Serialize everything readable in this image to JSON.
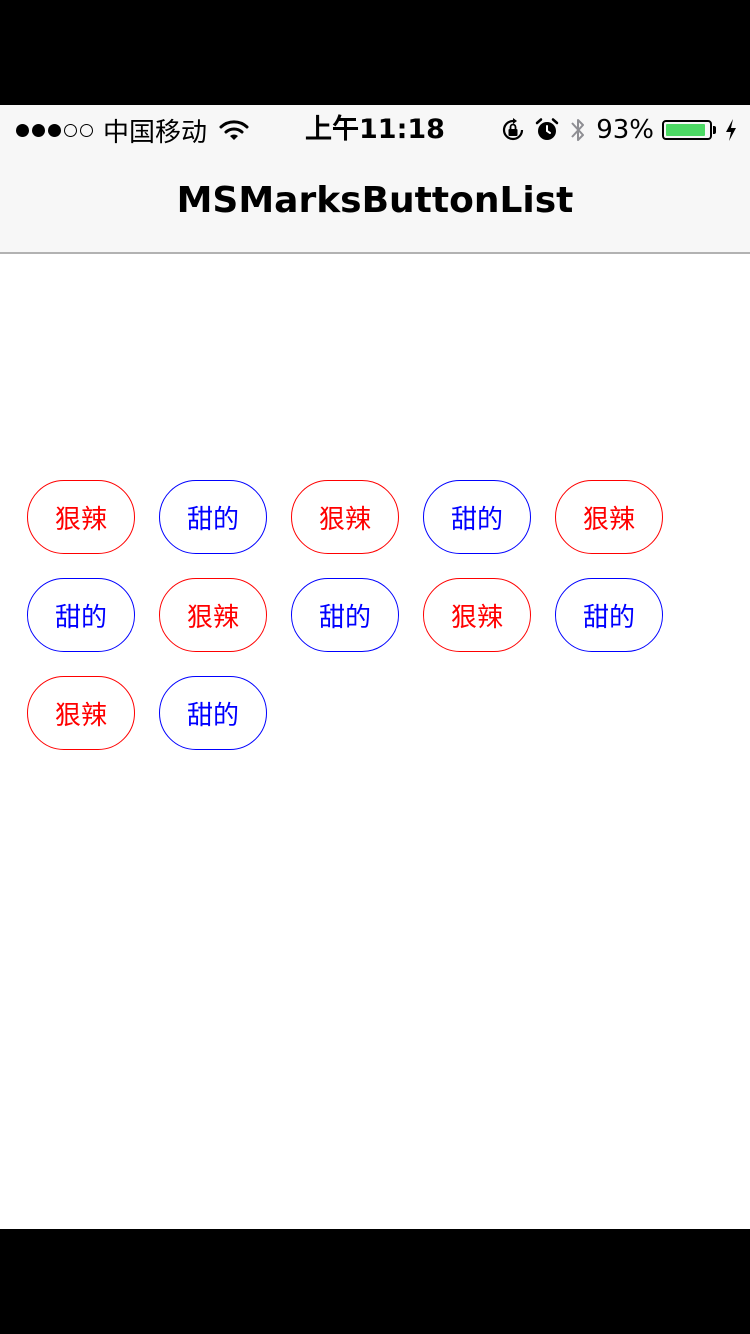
{
  "status_bar": {
    "carrier": "中国移动",
    "time": "上午11:18",
    "battery_percent": "93%",
    "battery_level": 0.93,
    "signal_bars_filled": 3,
    "signal_bars_total": 5,
    "icons": [
      "wifi-icon",
      "orientation-lock-icon",
      "alarm-icon",
      "bluetooth-icon",
      "battery-icon",
      "charging-bolt-icon"
    ]
  },
  "nav": {
    "title": "MSMarksButtonList"
  },
  "colors": {
    "spicy": "#ff0000",
    "sweet": "#0000ff",
    "battery_fill": "#4cd964"
  },
  "tags": [
    {
      "label": "狠辣",
      "style": "red"
    },
    {
      "label": "甜的",
      "style": "blue"
    },
    {
      "label": "狠辣",
      "style": "red"
    },
    {
      "label": "甜的",
      "style": "blue"
    },
    {
      "label": "狠辣",
      "style": "red"
    },
    {
      "label": "甜的",
      "style": "blue"
    },
    {
      "label": "狠辣",
      "style": "red"
    },
    {
      "label": "甜的",
      "style": "blue"
    },
    {
      "label": "狠辣",
      "style": "red"
    },
    {
      "label": "甜的",
      "style": "blue"
    },
    {
      "label": "狠辣",
      "style": "red"
    },
    {
      "label": "甜的",
      "style": "blue"
    }
  ]
}
